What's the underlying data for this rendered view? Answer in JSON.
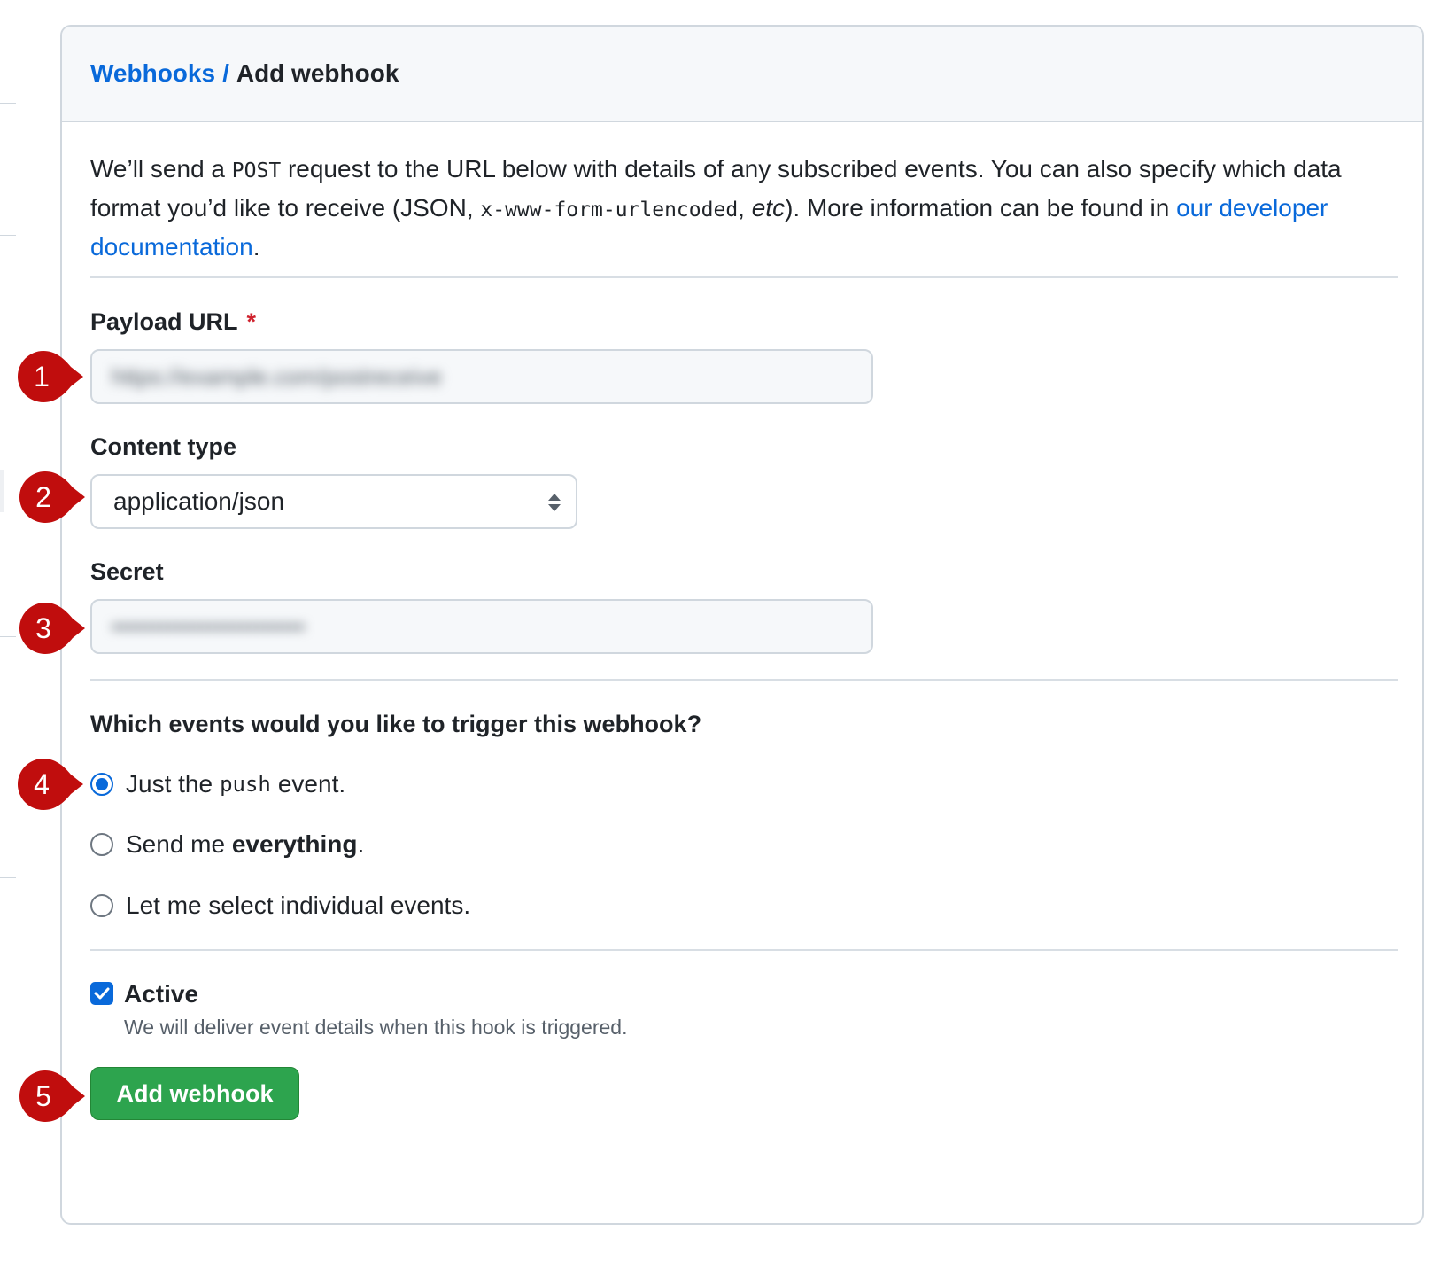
{
  "breadcrumb": {
    "parent": "Webhooks",
    "separator": "/",
    "current": "Add webhook"
  },
  "intro": {
    "text_1": "We’ll send a ",
    "code_post": "POST",
    "text_2": " request to the URL below with details of any subscribed events. You can also specify which data format you’d like to receive (JSON, ",
    "code_form": "x-www-form-urlencoded",
    "text_3": ", ",
    "etc": "etc",
    "text_4": "). More information can be found in ",
    "link": "our developer documentation",
    "text_5": "."
  },
  "payload_url": {
    "label": "Payload URL",
    "required_mark": "*",
    "value": "https://example.com/postreceive"
  },
  "content_type": {
    "label": "Content type",
    "selected": "application/json"
  },
  "secret": {
    "label": "Secret",
    "value": "••••••••••••••••••••••••"
  },
  "events": {
    "question": "Which events would you like to trigger this webhook?",
    "option_push_prefix": "Just the",
    "option_push_code": "push",
    "option_push_suffix": "event.",
    "option_everything_prefix": "Send me ",
    "option_everything_bold": "everything",
    "option_everything_suffix": ".",
    "option_individual": "Let me select individual events.",
    "selected": "push"
  },
  "active": {
    "label": "Active",
    "checked": true,
    "description": "We will deliver event details when this hook is triggered."
  },
  "submit": {
    "label": "Add webhook"
  },
  "markers": [
    "1",
    "2",
    "3",
    "4",
    "5"
  ],
  "colors": {
    "link": "#0969da",
    "marker": "#c00d0d",
    "submit": "#2da44e",
    "required": "#cf222e"
  }
}
